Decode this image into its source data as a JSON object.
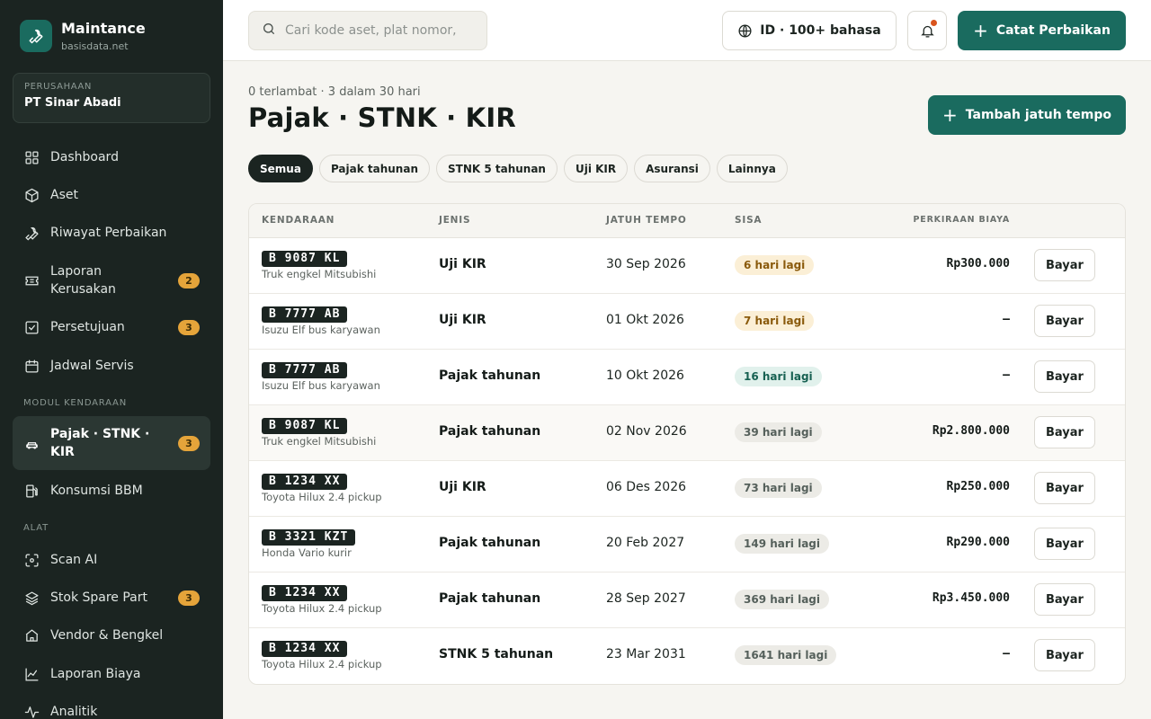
{
  "brand": {
    "name": "Maintance",
    "domain": "basisdata.net"
  },
  "company": {
    "label": "PERUSAHAAN",
    "name": "PT Sinar Abadi"
  },
  "sidebar": {
    "items": [
      {
        "label": "Dashboard",
        "icon": "grid-icon"
      },
      {
        "label": "Aset",
        "icon": "box-icon"
      },
      {
        "label": "Riwayat Perbaikan",
        "icon": "wrench-icon"
      },
      {
        "label": "Laporan Kerusakan",
        "icon": "ticket-icon",
        "badge": "2"
      },
      {
        "label": "Persetujuan",
        "icon": "check-square-icon",
        "badge": "3"
      },
      {
        "label": "Jadwal Servis",
        "icon": "calendar-icon"
      }
    ],
    "section_vehicle": "MODUL KENDARAAN",
    "vehicle_items": [
      {
        "label": "Pajak · STNK · KIR",
        "icon": "car-icon",
        "badge": "3",
        "active": true
      },
      {
        "label": "Konsumsi BBM",
        "icon": "fuel-icon"
      }
    ],
    "section_tools": "ALAT",
    "tool_items": [
      {
        "label": "Scan AI",
        "icon": "scan-icon"
      },
      {
        "label": "Stok Spare Part",
        "icon": "layers-icon",
        "badge": "3"
      },
      {
        "label": "Vendor & Bengkel",
        "icon": "store-icon"
      },
      {
        "label": "Laporan Biaya",
        "icon": "chart-line-icon"
      },
      {
        "label": "Analitik",
        "icon": "pulse-icon"
      }
    ]
  },
  "topbar": {
    "search_placeholder": "Cari kode aset, plat nomor,",
    "language": "ID · 100+ bahasa",
    "new_repair": "Catat Perbaikan"
  },
  "main": {
    "subtitle": "0 terlambat · 3 dalam 30 hari",
    "title": "Pajak · STNK · KIR",
    "add_button": "Tambah jatuh tempo",
    "filters": [
      "Semua",
      "Pajak tahunan",
      "STNK 5 tahunan",
      "Uji KIR",
      "Asuransi",
      "Lainnya"
    ],
    "active_filter": "Semua",
    "columns": {
      "vehicle": "KENDARAAN",
      "type": "JENIS",
      "due": "JATUH TEMPO",
      "remaining": "SISA",
      "cost": "PERKIRAAN BIAYA"
    },
    "pay_label": "Bayar",
    "rows": [
      {
        "plate": "B 9087 KL",
        "vehicle": "Truk engkel Mitsubishi",
        "type": "Uji KIR",
        "due": "30 Sep 2026",
        "remaining": "6 hari lagi",
        "status": "warn",
        "cost": "Rp300.000"
      },
      {
        "plate": "B 7777 AB",
        "vehicle": "Isuzu Elf bus karyawan",
        "type": "Uji KIR",
        "due": "01 Okt 2026",
        "remaining": "7 hari lagi",
        "status": "warn",
        "cost": "–"
      },
      {
        "plate": "B 7777 AB",
        "vehicle": "Isuzu Elf bus karyawan",
        "type": "Pajak tahunan",
        "due": "10 Okt 2026",
        "remaining": "16 hari lagi",
        "status": "ok",
        "cost": "–"
      },
      {
        "plate": "B 9087 KL",
        "vehicle": "Truk engkel Mitsubishi",
        "type": "Pajak tahunan",
        "due": "02 Nov 2026",
        "remaining": "39 hari lagi",
        "status": "neutral",
        "cost": "Rp2.800.000"
      },
      {
        "plate": "B 1234 XX",
        "vehicle": "Toyota Hilux 2.4 pickup",
        "type": "Uji KIR",
        "due": "06 Des 2026",
        "remaining": "73 hari lagi",
        "status": "neutral",
        "cost": "Rp250.000"
      },
      {
        "plate": "B 3321 KZT",
        "vehicle": "Honda Vario kurir",
        "type": "Pajak tahunan",
        "due": "20 Feb 2027",
        "remaining": "149 hari lagi",
        "status": "neutral",
        "cost": "Rp290.000"
      },
      {
        "plate": "B 1234 XX",
        "vehicle": "Toyota Hilux 2.4 pickup",
        "type": "Pajak tahunan",
        "due": "28 Sep 2027",
        "remaining": "369 hari lagi",
        "status": "neutral",
        "cost": "Rp3.450.000"
      },
      {
        "plate": "B 1234 XX",
        "vehicle": "Toyota Hilux 2.4 pickup",
        "type": "STNK 5 tahunan",
        "due": "23 Mar 2031",
        "remaining": "1641 hari lagi",
        "status": "neutral",
        "cost": "–"
      }
    ]
  }
}
